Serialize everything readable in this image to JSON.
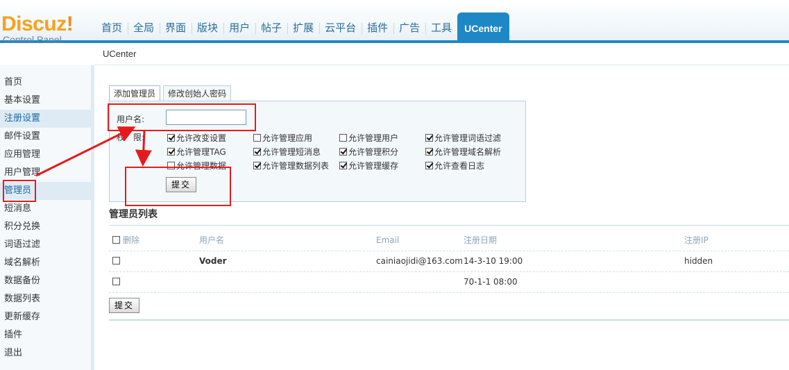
{
  "logo": {
    "brand": "Discuz",
    "bang": "!",
    "subtitle": "Control Panel"
  },
  "nav": [
    "首页",
    "全局",
    "界面",
    "版块",
    "用户",
    "帖子",
    "扩展",
    "云平台",
    "插件",
    "广告",
    "工具",
    "UCenter"
  ],
  "nav_active": "UCenter",
  "breadcrumb": "UCenter",
  "sidebar": [
    "首页",
    "基本设置",
    "注册设置",
    "邮件设置",
    "应用管理",
    "用户管理",
    "管理员",
    "短消息",
    "积分兑换",
    "词语过滤",
    "域名解析",
    "数据备份",
    "数据列表",
    "更新缓存",
    "插件",
    "退出"
  ],
  "sidebar_current": "管理员",
  "tabs": [
    "添加管理员",
    "修改创始人密码"
  ],
  "form": {
    "username_label": "用户名:",
    "username_value": "",
    "perm_label": "权　限:",
    "permissions": [
      {
        "label": "允许改变设置",
        "checked": true
      },
      {
        "label": "允许管理应用",
        "checked": false
      },
      {
        "label": "允许管理用户",
        "checked": false
      },
      {
        "label": "允许管理词语过滤",
        "checked": true
      },
      {
        "label": "允许管理TAG",
        "checked": true
      },
      {
        "label": "允许管理短消息",
        "checked": true
      },
      {
        "label": "允许管理积分",
        "checked": true
      },
      {
        "label": "允许管理域名解析",
        "checked": true
      },
      {
        "label": "允许管理数据",
        "checked": false
      },
      {
        "label": "允许管理数据列表",
        "checked": true
      },
      {
        "label": "允许管理缓存",
        "checked": true
      },
      {
        "label": "允许查看日志",
        "checked": true
      }
    ],
    "submit": "提交"
  },
  "list": {
    "title": "管理员列表",
    "columns": [
      "删除",
      "用户名",
      "Email",
      "注册日期",
      "注册IP"
    ],
    "rows": [
      {
        "username": "Voder",
        "email": "cainiaojidi@163.com",
        "date": "14-3-10 19:00",
        "ip": "hidden"
      },
      {
        "username": "",
        "email": "",
        "date": "70-1-1 08:00",
        "ip": ""
      }
    ],
    "submit": "提交"
  },
  "colors": {
    "accent": "#1e88c7",
    "annotation": "#e51b1b",
    "logo": "#f7a21b"
  }
}
